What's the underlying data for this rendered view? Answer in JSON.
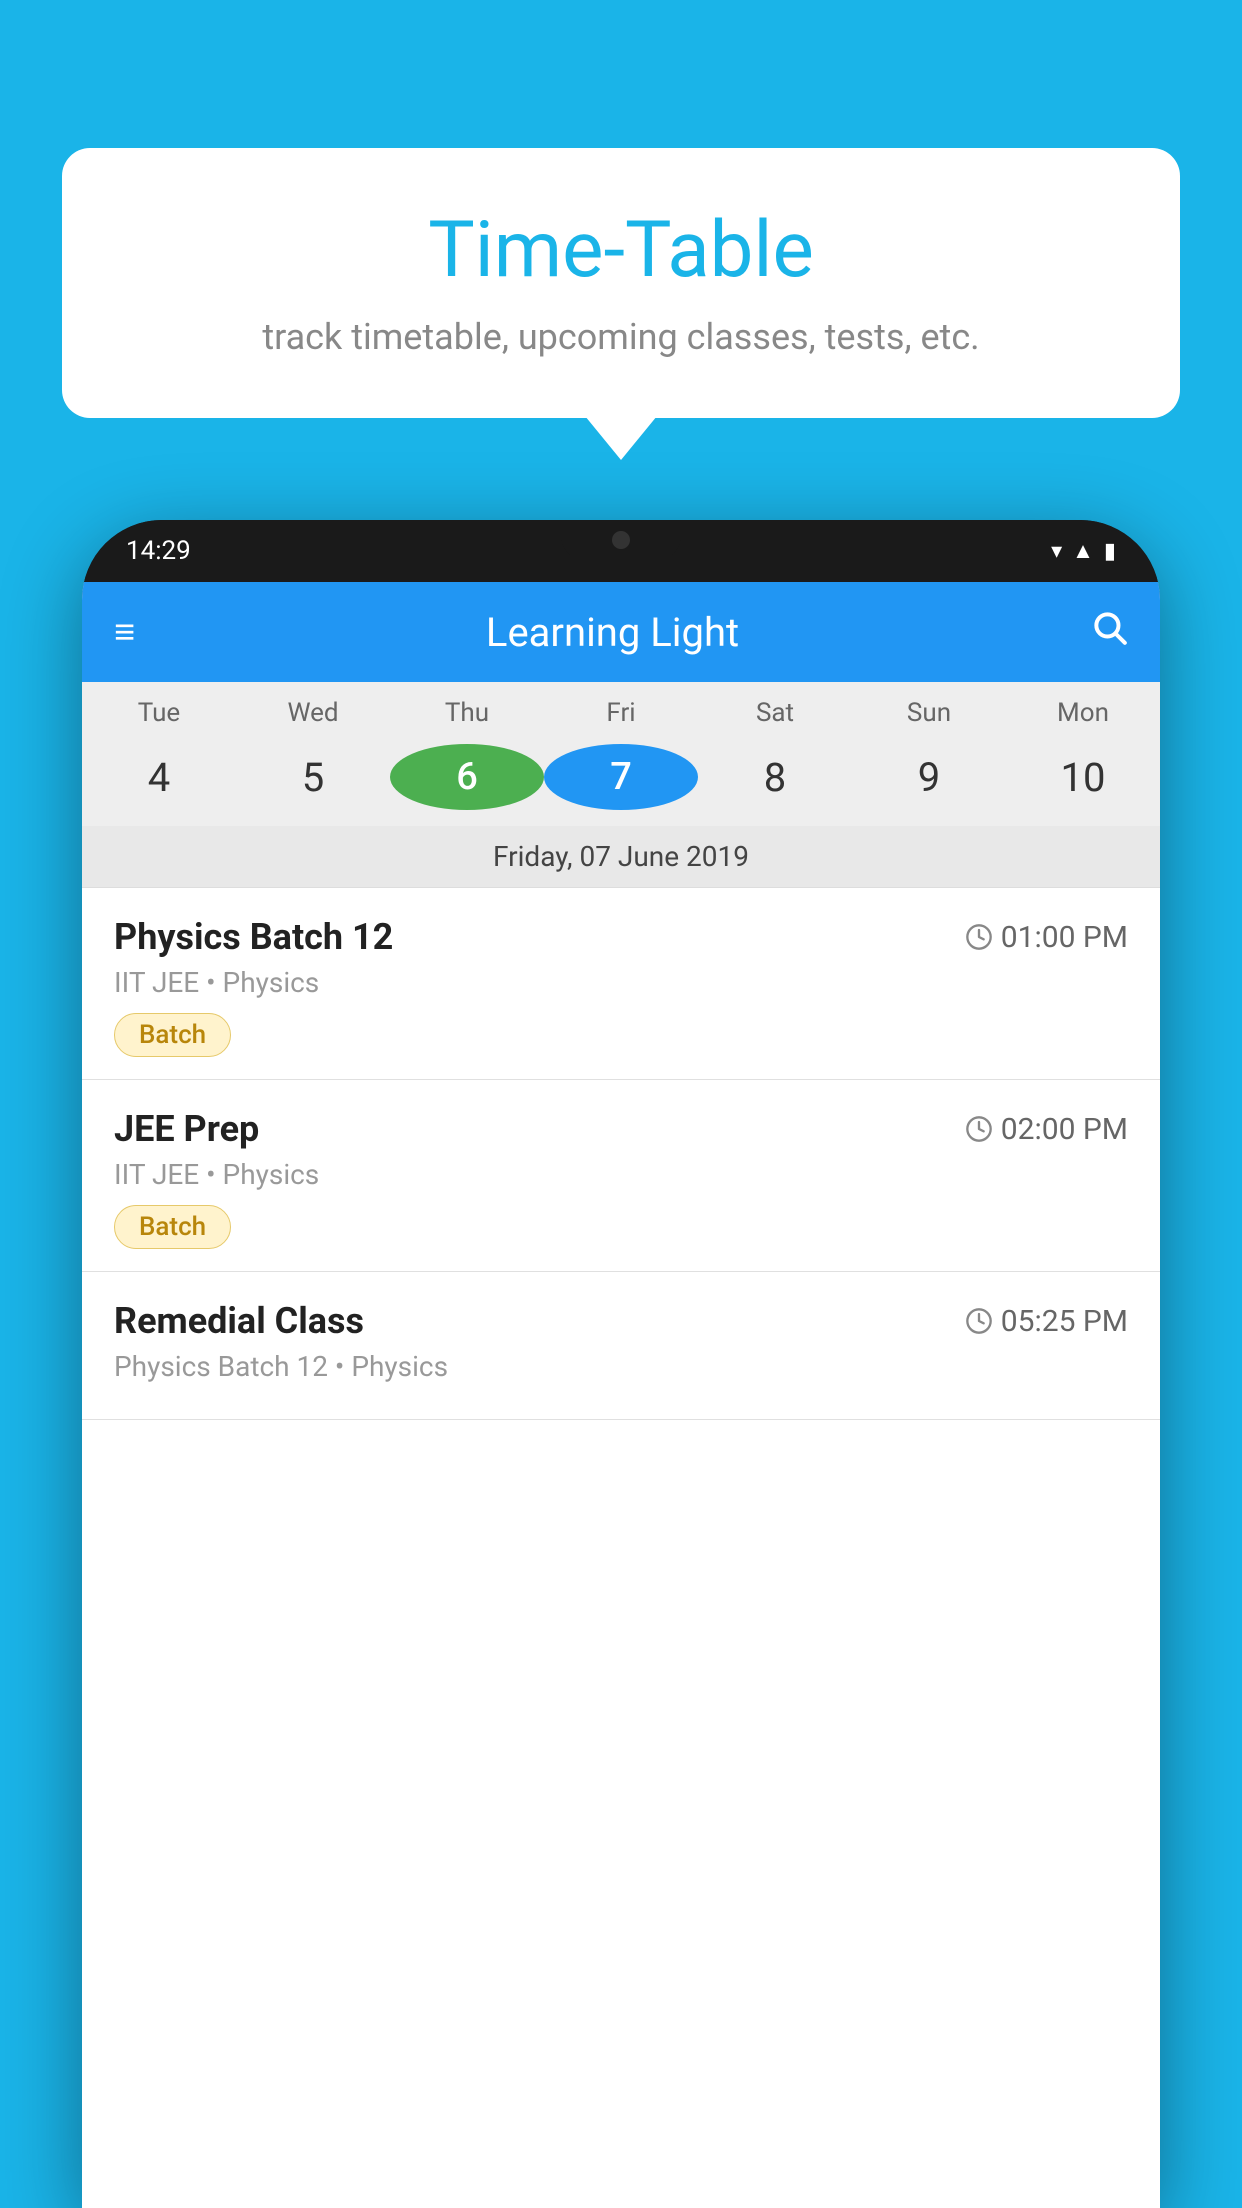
{
  "background_color": "#1ab4e8",
  "speech_bubble": {
    "title": "Time-Table",
    "subtitle": "track timetable, upcoming classes, tests, etc."
  },
  "phone": {
    "status_bar": {
      "time": "14:29"
    },
    "app_bar": {
      "title": "Learning Light"
    },
    "calendar": {
      "days": [
        {
          "short": "Tue",
          "num": "4"
        },
        {
          "short": "Wed",
          "num": "5"
        },
        {
          "short": "Thu",
          "num": "6",
          "state": "today"
        },
        {
          "short": "Fri",
          "num": "7",
          "state": "selected"
        },
        {
          "short": "Sat",
          "num": "8"
        },
        {
          "short": "Sun",
          "num": "9"
        },
        {
          "short": "Mon",
          "num": "10"
        }
      ],
      "selected_date_label": "Friday, 07 June 2019"
    },
    "schedule": [
      {
        "name": "Physics Batch 12",
        "time": "01:00 PM",
        "meta": "IIT JEE • Physics",
        "badge": "Batch"
      },
      {
        "name": "JEE Prep",
        "time": "02:00 PM",
        "meta": "IIT JEE • Physics",
        "badge": "Batch"
      },
      {
        "name": "Remedial Class",
        "time": "05:25 PM",
        "meta": "Physics Batch 12 • Physics",
        "badge": null
      }
    ]
  },
  "icons": {
    "hamburger": "≡",
    "search": "🔍",
    "clock": "🕐"
  }
}
